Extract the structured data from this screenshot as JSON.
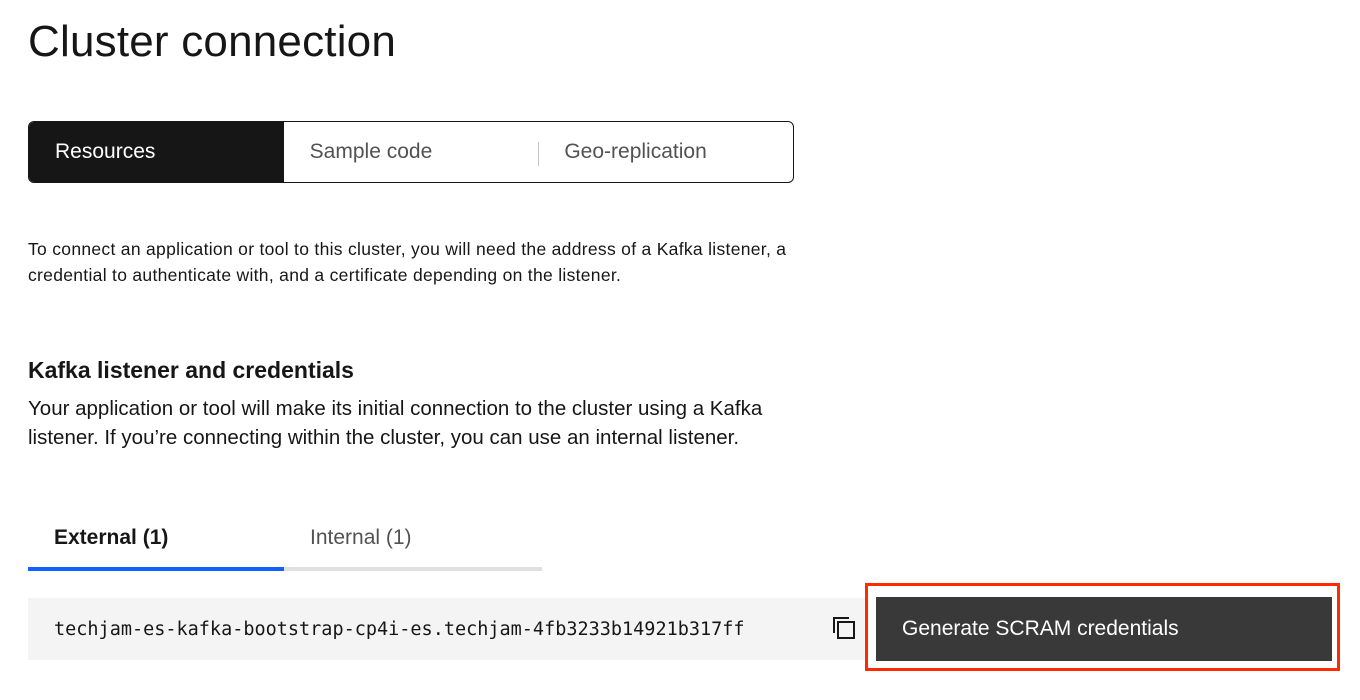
{
  "page": {
    "title": "Cluster connection"
  },
  "content_switcher": {
    "items": [
      {
        "label": "Resources",
        "selected": true
      },
      {
        "label": "Sample code",
        "selected": false
      },
      {
        "label": "Geo-replication",
        "selected": false
      }
    ]
  },
  "intro": {
    "text": "To connect an application or tool to this cluster, you will need the address of a Kafka listener, a credential to authenticate with, and a certificate depending on the listener."
  },
  "kafka_section": {
    "heading": "Kafka listener and credentials",
    "description": "Your application or tool will make its initial connection to the cluster using a Kafka listener. If you’re connecting within the cluster, you can use an internal listener.",
    "tabs": [
      {
        "label": "External (1)",
        "selected": true
      },
      {
        "label": "Internal (1)",
        "selected": false
      }
    ],
    "address": "techjam-es-kafka-bootstrap-cp4i-es.techjam-4fb3233b14921b317ff",
    "copy_icon": "copy-icon",
    "generate_button_label": "Generate SCRAM credentials"
  },
  "colors": {
    "selected_switch_bg": "#161616",
    "tab_active_indicator": "#0f62fe",
    "button_bg": "#393939",
    "highlight_border": "#ff2a00",
    "field_bg": "#f4f4f4"
  }
}
